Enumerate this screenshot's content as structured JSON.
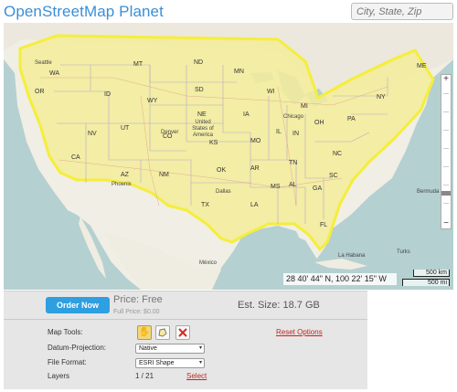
{
  "header": {
    "title": "OpenStreetMap Planet",
    "search_placeholder": "City, State, Zip"
  },
  "map": {
    "coordinates": "28 40' 44\" N, 100 22' 15\" W",
    "scale_top": "500 km",
    "scale_bottom": "500 mi",
    "zoom_in_symbol": "+",
    "zoom_out_symbol": "−",
    "place_labels": {
      "seattle": "Seattle",
      "wa": "WA",
      "mt": "MT",
      "nd": "ND",
      "mn": "MN",
      "or": "OR",
      "id": "ID",
      "sd": "SD",
      "wi": "WI",
      "mi": "MI",
      "ny": "NY",
      "me": "ME",
      "wy": "WY",
      "ne": "NE",
      "ia": "IA",
      "pa": "PA",
      "nv": "NV",
      "ut": "UT",
      "co": "CO",
      "united_states": "United States of America",
      "ks": "KS",
      "mo": "MO",
      "il": "IL",
      "in": "IN",
      "oh": "OH",
      "ca": "CA",
      "denver": "Denver",
      "chicago": "Chicago",
      "az": "AZ",
      "nm": "NM",
      "ok": "OK",
      "ar": "AR",
      "tn": "TN",
      "nc": "NC",
      "phoenix": "Phoenix",
      "dallas": "Dallas",
      "tx": "TX",
      "la": "LA",
      "ms": "MS",
      "al": "AL",
      "ga": "GA",
      "sc": "SC",
      "fl": "FL",
      "mexico": "México",
      "havana": "La Habana",
      "bermuda": "Bermuda",
      "bahamas": "Turks"
    },
    "selection_color": "#f5ee3a",
    "fill_color": "#f3ec9a"
  },
  "panel": {
    "order_button": "Order Now",
    "price": "Price: Free",
    "full_price": "Full Price: $0.00",
    "est_size": "Est. Size: 18.7 GB",
    "map_tools_label": "Map Tools:",
    "reset_options": "Reset Options",
    "datum_label": "Datum-Projection:",
    "datum_value": "Native",
    "file_format_label": "File Format:",
    "file_format_value": "ESRI Shape",
    "layers_label": "Layers",
    "layers_count": "1 / 21",
    "select_link": "Select"
  },
  "icons": {
    "hand": "hand-icon",
    "polygon": "polygon-icon",
    "clear": "clear-icon"
  }
}
